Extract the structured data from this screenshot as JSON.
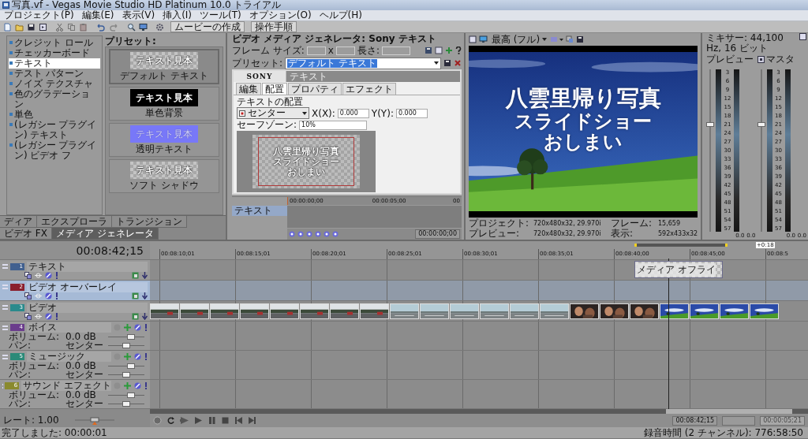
{
  "window": {
    "title": "写真.vf - Vegas Movie Studio HD Platinum 10.0 トライアル"
  },
  "menu": [
    "プロジェクト(P)",
    "編集(E)",
    "表示(V)",
    "挿入(I)",
    "ツール(T)",
    "オプション(O)",
    "ヘルプ(H)"
  ],
  "toolbar": {
    "buttons": [
      "ムービーの作成",
      "操作手順"
    ]
  },
  "generators": {
    "items": [
      {
        "label": "クレジット ロール",
        "selected": false
      },
      {
        "label": "チェッカーボード",
        "selected": false
      },
      {
        "label": "テキスト",
        "selected": true
      },
      {
        "label": "テスト パターン",
        "selected": false
      },
      {
        "label": "ノイズ テクスチャ",
        "selected": false
      },
      {
        "label": "色のグラデーション",
        "selected": false
      },
      {
        "label": "単色",
        "selected": false
      },
      {
        "label": "(レガシー プラグイン) テキスト",
        "selected": false
      },
      {
        "label": "(レガシー プラグイン) ビデオ フ",
        "selected": false
      }
    ],
    "presets_title": "プリセット:",
    "presets": [
      {
        "label": "デフォルト テキスト",
        "sample": "テキスト見本",
        "kind": "checker",
        "selected": true
      },
      {
        "label": "単色背景",
        "sample": "テキスト見本",
        "kind": "black",
        "selected": false
      },
      {
        "label": "透明テキスト",
        "sample": "テキスト見本",
        "kind": "blue",
        "selected": false
      },
      {
        "label": "ソフト シャドウ",
        "sample": "テキスト見本",
        "kind": "checker",
        "selected": false
      }
    ]
  },
  "dock_tabs": [
    {
      "label": "ディア",
      "selected": false
    },
    {
      "label": "エクスプローラ",
      "selected": false
    },
    {
      "label": "トランジション",
      "selected": false
    },
    {
      "label": "ビデオ FX",
      "selected": false
    },
    {
      "label": "メディア ジェネレータ",
      "selected": true
    }
  ],
  "media_generator": {
    "title": "ビデオ メディア ジェネレータ: Sony テキスト",
    "frame_size_label": "フレーム サイズ:",
    "times": "x",
    "length_label": "長さ:",
    "preset_label": "プリセット:",
    "preset_value": "デフォルト テキスト",
    "plugin_logo": "SONY",
    "plugin_name": "テキスト",
    "tabs": [
      {
        "label": "編集",
        "selected": false
      },
      {
        "label": "配置",
        "selected": true
      },
      {
        "label": "プロパティ",
        "selected": false
      },
      {
        "label": "エフェクト",
        "selected": false
      }
    ],
    "placement_label": "テキストの配置",
    "placement_value": "センター",
    "x_label": "X(X):",
    "x_value": "0.000",
    "y_label": "Y(Y):",
    "y_value": "0.000",
    "safe_zone_label": "セーフゾーン:",
    "safe_zone_value": "10%",
    "preview_lines": [
      "八雲里帰り写真",
      "スライドショー",
      "おしまい"
    ],
    "keyframes": {
      "track": "テキスト",
      "ruler": [
        "00:00:00;00",
        "00:00:05;00",
        "00"
      ],
      "time": "00:00:00;00"
    }
  },
  "preview": {
    "quality": "最高 (フル)",
    "title_lines": [
      "八雲里帰り写真",
      "スライドショー",
      "おしまい"
    ],
    "info": [
      {
        "label": "プロジェクト:",
        "value": "720x480x32, 29.970i"
      },
      {
        "label": "フレーム:",
        "value": "15,659"
      },
      {
        "label": "プレビュー:",
        "value": "720x480x32, 29.970i"
      },
      {
        "label": "表示:",
        "value": "592x433x32"
      }
    ]
  },
  "mixer": {
    "title": "ミキサー: 44,100 Hz, 16 ビット",
    "channels": [
      {
        "name": "プレビュー",
        "level": 0.66,
        "scale": [
          "3",
          "6",
          "9",
          "12",
          "15",
          "18",
          "21",
          "24",
          "27",
          "30",
          "33",
          "36",
          "39",
          "42",
          "45",
          "48",
          "51",
          "54",
          "57"
        ],
        "readings": [
          "0.0",
          "0.0"
        ]
      },
      {
        "name": "マスタ",
        "level": 0.66,
        "scale": [
          "3",
          "6",
          "9",
          "12",
          "15",
          "18",
          "21",
          "24",
          "27",
          "30",
          "33",
          "36",
          "39",
          "42",
          "45",
          "48",
          "51",
          "54",
          "57"
        ],
        "readings": [
          "0.0",
          "0.0"
        ]
      }
    ]
  },
  "timeline": {
    "time": "00:08:42;15",
    "marker": "+0:18",
    "ruler": [
      "00:08:10;01",
      "00:08:15;01",
      "00:08:20;01",
      "00:08:25;01",
      "00:08:30;01",
      "00:08:35;01",
      "00:08:40;00",
      "00:08:45;00",
      "00:08:5"
    ],
    "tracks": [
      {
        "number": "1",
        "name": "テキスト",
        "kind": "video",
        "color": "#41608f",
        "selected": false
      },
      {
        "number": "2",
        "name": "ビデオ オーバーレイ",
        "kind": "video",
        "color": "#8a1f2e",
        "selected": true
      },
      {
        "number": "3",
        "name": "ビデオ",
        "kind": "video",
        "color": "#2a8a8c",
        "selected": false
      },
      {
        "number": "4",
        "name": "ボイス",
        "kind": "audio",
        "color": "#6a3c8c",
        "selected": false,
        "volume": {
          "label": "ボリューム:",
          "value": "0.0 dB",
          "level": 0.62
        },
        "pan": {
          "label": "パン:",
          "value": "センター",
          "level": 0.5
        }
      },
      {
        "number": "5",
        "name": "ミュージック",
        "kind": "audio",
        "color": "#2a8a78",
        "selected": false,
        "volume": {
          "label": "ボリューム:",
          "value": "0.0 dB",
          "level": 0.62
        },
        "pan": {
          "label": "パン:",
          "value": "センター",
          "level": 0.5
        }
      },
      {
        "number": "6",
        "name": "サウンド エフェクト",
        "kind": "audio",
        "color": "#8a8a2e",
        "selected": false,
        "volume": {
          "label": "ボリューム:",
          "value": "0.0 dB",
          "level": 0.62
        },
        "pan": {
          "label": "パン:",
          "value": "センター",
          "level": 0.5
        }
      }
    ],
    "text_clip": "メディア オフライ",
    "rate": "レート: 1.00",
    "cursor_time": "00:08:42;15",
    "selection_length": "00:00:05;21"
  },
  "status": {
    "left": "完了しました: 00:00:01",
    "right": "録音時間 (2 チャンネル): 776:58:50"
  }
}
